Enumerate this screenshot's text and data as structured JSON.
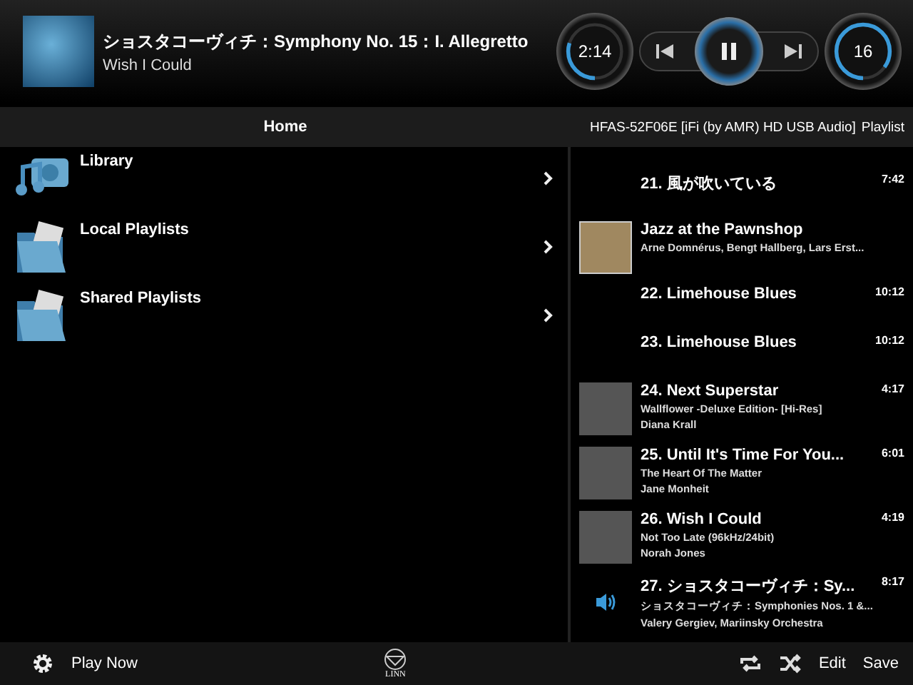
{
  "now_playing": {
    "title": "ショスタコーヴィチ：Symphony No. 15：I. Allegretto",
    "subtitle": "Wish I Could",
    "elapsed": "2:14",
    "progress": {
      "level": 0.3
    },
    "volume": "16",
    "volume_level": {
      "level": 0.85
    },
    "playing": true
  },
  "nav": {
    "home": "Home",
    "device": "HFAS-52F06E [iFi (by AMR) HD USB Audio]",
    "playlist": "Playlist"
  },
  "menu": [
    {
      "label": "Library",
      "kind": "library"
    },
    {
      "label": "Local Playlists",
      "kind": "folder"
    },
    {
      "label": "Shared Playlists",
      "kind": "folder"
    }
  ],
  "playlist": [
    {
      "kind": "track",
      "title": "21. 風が吹いている",
      "duration": "7:42",
      "has_art": false,
      "playing": false
    },
    {
      "kind": "album",
      "title": "Jazz at the Pawnshop",
      "artist": "Arne Domnérus, Bengt Hallberg, Lars Erst..."
    },
    {
      "kind": "track",
      "title": "22. Limehouse Blues",
      "duration": "10:12",
      "has_art": false,
      "playing": false
    },
    {
      "kind": "track",
      "title": "23. Limehouse Blues",
      "duration": "10:12",
      "has_art": false,
      "playing": false
    },
    {
      "kind": "track",
      "title": "24. Next Superstar",
      "album": "Wallflower -Deluxe Edition- [Hi-Res]",
      "artist": "Diana Krall",
      "duration": "4:17",
      "has_art": true,
      "playing": false
    },
    {
      "kind": "track",
      "title": "25. Until It's Time For You...",
      "album": "The Heart Of The Matter",
      "artist": "Jane Monheit",
      "duration": "6:01",
      "has_art": true,
      "playing": false
    },
    {
      "kind": "track",
      "title": "26. Wish I Could",
      "album": "Not Too Late (96kHz/24bit)",
      "artist": "Norah Jones",
      "duration": "4:19",
      "has_art": true,
      "playing": false
    },
    {
      "kind": "track",
      "title": "27. ショスタコーヴィチ：Sy...",
      "album": "ショスタコーヴィチ：Symphonies Nos. 1 &...",
      "artist": "Valery Gergiev, Mariinsky Orchestra",
      "duration": "8:17",
      "has_art": false,
      "playing": true
    }
  ],
  "footer": {
    "play_mode": "Play Now",
    "logo": "LINN",
    "edit": "Edit",
    "save": "Save"
  }
}
